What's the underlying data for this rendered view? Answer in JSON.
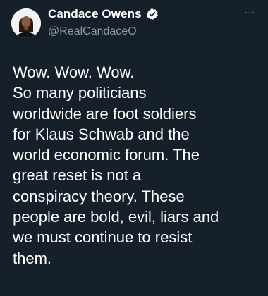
{
  "author": {
    "display_name": "Candace Owens",
    "handle": "@RealCandaceO",
    "verified": true,
    "avatar_icon": "profile-photo"
  },
  "menu": {
    "icon": "more-options-icon",
    "label": "···"
  },
  "tweet": {
    "lines": [
      "Wow. Wow. Wow.",
      "So many politicians",
      "worldwide are foot soldiers",
      "for Klaus Schwab and the",
      "world economic forum. The",
      "great reset is not a",
      "conspiracy theory. These",
      "people are bold, evil, liars and",
      "we must continue to resist",
      "them."
    ]
  },
  "colors": {
    "background": "#15202b",
    "text": "#ffffff",
    "secondary_text": "#8b98a5",
    "verified_badge": "#ffffff"
  }
}
